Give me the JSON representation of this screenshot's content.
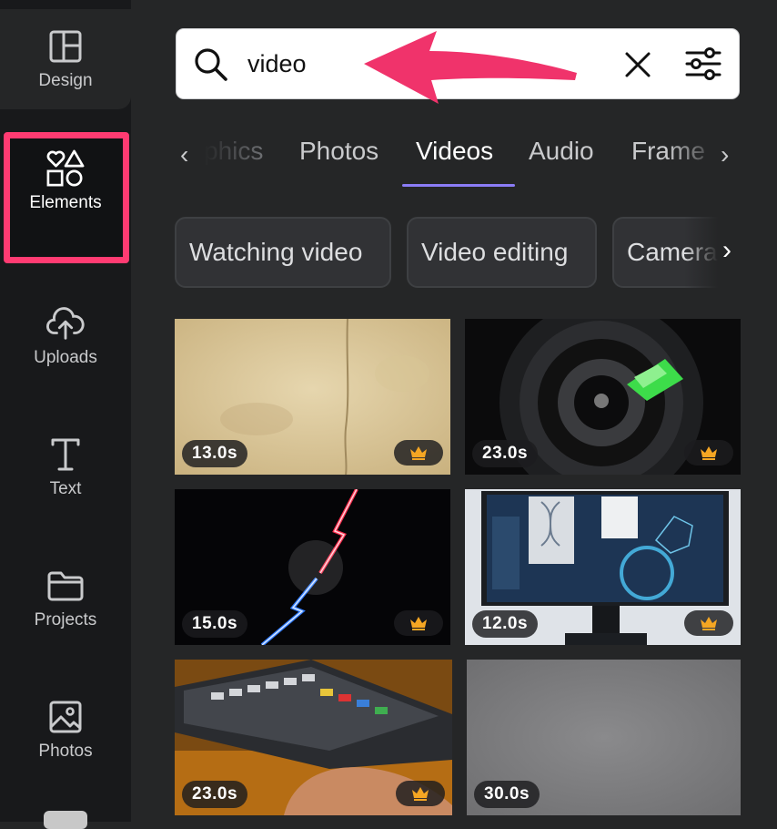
{
  "sidebar": {
    "items": [
      {
        "label": "Design",
        "icon": "layout-icon"
      },
      {
        "label": "Elements",
        "icon": "shapes-icon",
        "active": true
      },
      {
        "label": "Uploads",
        "icon": "cloud-upload-icon"
      },
      {
        "label": "Text",
        "icon": "text-icon"
      },
      {
        "label": "Projects",
        "icon": "folder-icon"
      },
      {
        "label": "Photos",
        "icon": "image-icon"
      }
    ]
  },
  "search": {
    "value": "video",
    "placeholder": ""
  },
  "tabs": {
    "items": [
      "phics",
      "Photos",
      "Videos",
      "Audio",
      "Frame"
    ],
    "active": "Videos"
  },
  "chips": [
    "Watching video",
    "Video editing",
    "Camera"
  ],
  "videos": [
    {
      "duration": "13.0s",
      "pro": true,
      "subject": "parchment"
    },
    {
      "duration": "23.0s",
      "pro": true,
      "subject": "camera-lens"
    },
    {
      "duration": "15.0s",
      "pro": true,
      "subject": "versus-lightning"
    },
    {
      "duration": "12.0s",
      "pro": true,
      "subject": "dna-monitor"
    },
    {
      "duration": "23.0s",
      "pro": true,
      "subject": "video-editing-console"
    },
    {
      "duration": "30.0s",
      "pro": false,
      "subject": "grey-noise"
    }
  ],
  "colors": {
    "accent_underline": "#8b7cf6",
    "highlight": "#ff3b72",
    "crown": "#f5a623"
  }
}
